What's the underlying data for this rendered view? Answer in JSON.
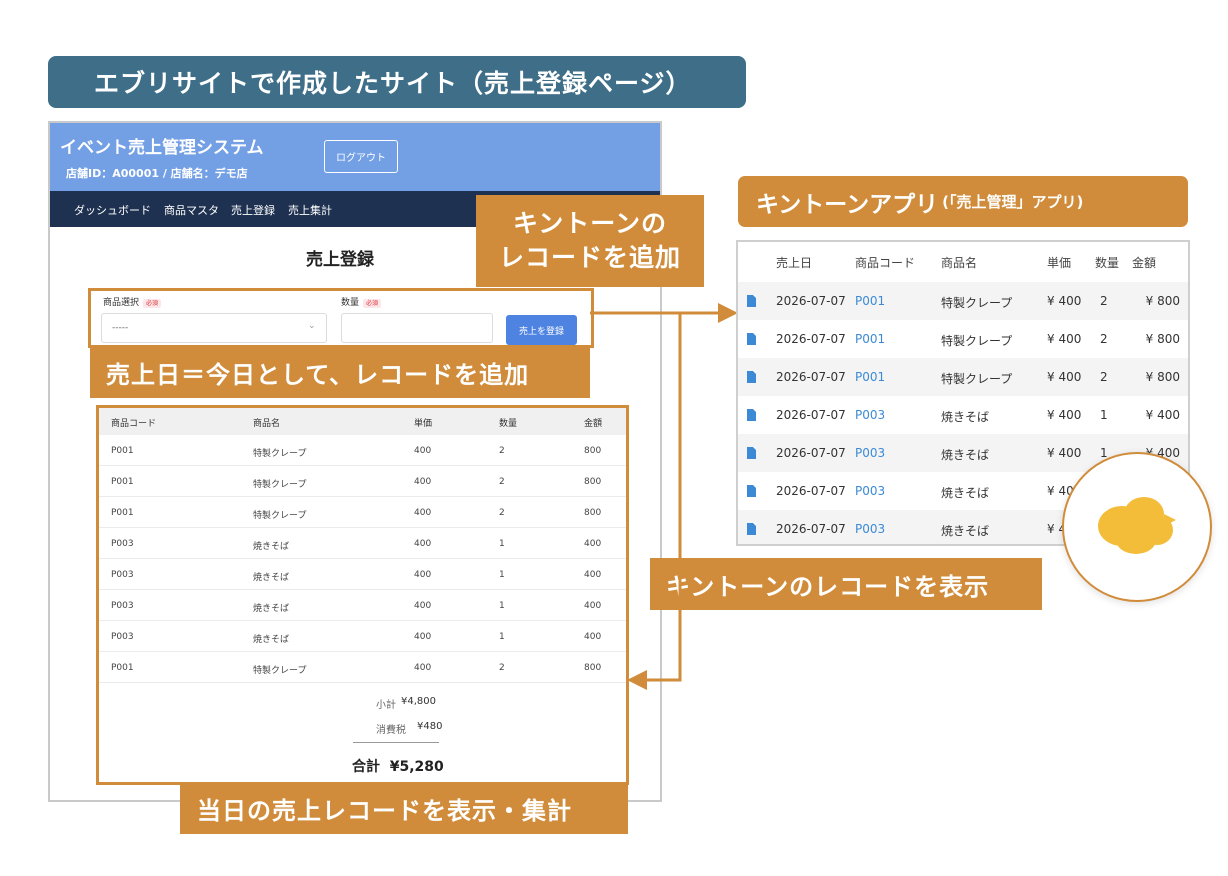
{
  "banner": {
    "title": "エブリサイトで作成したサイト（売上登録ページ）"
  },
  "site": {
    "title": "イベント売上管理システム",
    "store_info": "店舗ID：A00001 / 店舗名：デモ店",
    "logout_label": "ログアウト",
    "nav": [
      "ダッシュボード",
      "商品マスタ",
      "売上登録",
      "売上集計"
    ],
    "page_heading": "売上登録",
    "form": {
      "product_label": "商品選択",
      "qty_label": "数量",
      "required_badge": "必須",
      "select_value": "-----",
      "submit_label": "売上を登録"
    },
    "table": {
      "headers": [
        "商品コード",
        "商品名",
        "単価",
        "数量",
        "金額"
      ],
      "rows": [
        [
          "P001",
          "特製クレープ",
          "400",
          "2",
          "800"
        ],
        [
          "P001",
          "特製クレープ",
          "400",
          "2",
          "800"
        ],
        [
          "P001",
          "特製クレープ",
          "400",
          "2",
          "800"
        ],
        [
          "P003",
          "焼きそば",
          "400",
          "1",
          "400"
        ],
        [
          "P003",
          "焼きそば",
          "400",
          "1",
          "400"
        ],
        [
          "P003",
          "焼きそば",
          "400",
          "1",
          "400"
        ],
        [
          "P003",
          "焼きそば",
          "400",
          "1",
          "400"
        ],
        [
          "P001",
          "特製クレープ",
          "400",
          "2",
          "800"
        ]
      ]
    },
    "summary": {
      "subtotal_label": "小計",
      "subtotal_value": "¥4,800",
      "tax_label": "消費税",
      "tax_value": "¥480",
      "total_label": "合計",
      "total_value": "¥5,280"
    }
  },
  "callouts": {
    "add_record_line1": "キントーンの",
    "add_record_line2": "レコードを追加",
    "today_record": "売上日＝今日として、レコードを追加",
    "display_record": "キントーンのレコードを表示",
    "summary_record": "当日の売上レコードを表示・集計"
  },
  "kintone": {
    "label_main": "キントーンアプリ",
    "label_sub": "(「売上管理」アプリ)",
    "headers": [
      "売上日",
      "商品コード",
      "商品名",
      "単価",
      "数量",
      "金額"
    ],
    "rows": [
      [
        "2026-07-07",
        "P001",
        "特製クレープ",
        "¥ 400",
        "2",
        "¥ 800"
      ],
      [
        "2026-07-07",
        "P001",
        "特製クレープ",
        "¥ 400",
        "2",
        "¥ 800"
      ],
      [
        "2026-07-07",
        "P001",
        "特製クレープ",
        "¥ 400",
        "2",
        "¥ 800"
      ],
      [
        "2026-07-07",
        "P003",
        "焼きそば",
        "¥ 400",
        "1",
        "¥ 400"
      ],
      [
        "2026-07-07",
        "P003",
        "焼きそば",
        "¥ 400",
        "1",
        "¥ 400"
      ],
      [
        "2026-07-07",
        "P003",
        "焼きそば",
        "¥ 40",
        "",
        ""
      ],
      [
        "2026-07-07",
        "P003",
        "焼きそば",
        "¥ 4",
        "",
        ""
      ]
    ]
  },
  "colors": {
    "accent": "#d08c3a",
    "banner": "#3e6e88",
    "site_header": "#739fe4",
    "nav": "#1f3150",
    "link": "#3c8ad6"
  },
  "icons": {
    "record": "document-icon",
    "select": "chevron-down-icon",
    "mascot": "cloud-icon"
  }
}
